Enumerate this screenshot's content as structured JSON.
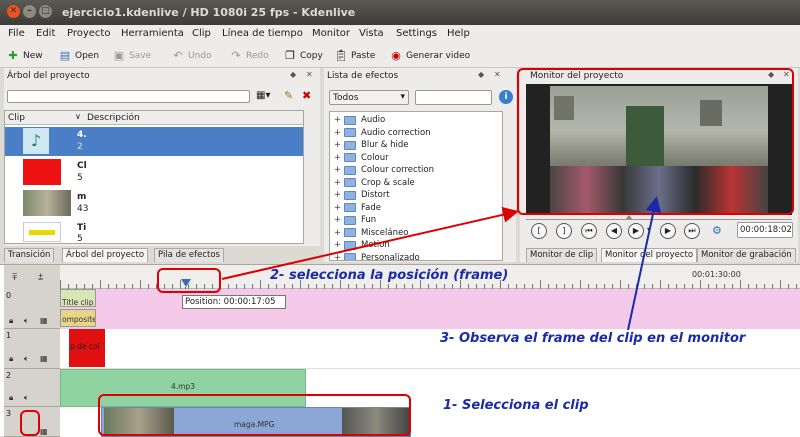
{
  "window": {
    "title": "ejercicio1.kdenlive / HD 1080i 25 fps - Kdenlive"
  },
  "menu": [
    "File",
    "Edit",
    "Proyecto",
    "Herramienta",
    "Clip",
    "Línea de tiempo",
    "Monitor",
    "Vista",
    "Settings",
    "Help"
  ],
  "toolbar": {
    "new": "New",
    "open": "Open",
    "save": "Save",
    "undo": "Undo",
    "redo": "Redo",
    "copy": "Copy",
    "paste": "Paste",
    "render": "Generar video"
  },
  "project_tree": {
    "title": "Árbol del proyecto",
    "col_clip": "Clip",
    "col_desc": "Descripción",
    "rows": [
      {
        "name": "4.",
        "sub": "2"
      },
      {
        "name": "Cl",
        "sub": "5"
      },
      {
        "name": "m",
        "sub": "43"
      },
      {
        "name": "Ti",
        "sub": "5"
      }
    ]
  },
  "effects": {
    "title": "Lista de efectos",
    "filter": "Todos",
    "items": [
      "Audio",
      "Audio correction",
      "Blur & hide",
      "Colour",
      "Colour correction",
      "Crop & scale",
      "Distort",
      "Fade",
      "Fun",
      "Misceláneo",
      "Motion",
      "Personalizado"
    ]
  },
  "monitor": {
    "title": "Monitor del proyecto",
    "timecode": "00:00:18:02"
  },
  "left_tabs": [
    "Transición",
    "Árbol del proyecto",
    "Pila de efectos"
  ],
  "right_tabs": [
    "Monitor de clip",
    "Monitor del proyecto",
    "Monitor de grabación"
  ],
  "timeline": {
    "position_label": "Position: 00:00:17:05",
    "ruler_mark": "00:01:30:00",
    "tracks": [
      {
        "num": "0"
      },
      {
        "num": "1"
      },
      {
        "num": "2"
      },
      {
        "num": "3"
      }
    ],
    "clips": {
      "title_clip": "Title clip",
      "composite": "omposite",
      "color_clip": "p de col",
      "audio_clip": "4.mp3",
      "video_clip": "maga.MPG"
    }
  },
  "annotations": {
    "step1": "1- Selecciona el clip",
    "step2": "2- selecciona la posición (frame)",
    "step3": "3- Observa el frame del clip en el monitor"
  },
  "colors": {
    "title_bg": "#3c3b37",
    "annot_blue": "#1a2aa8",
    "annot_red": "#dd0000",
    "selection_blue": "#4a7fc7"
  }
}
